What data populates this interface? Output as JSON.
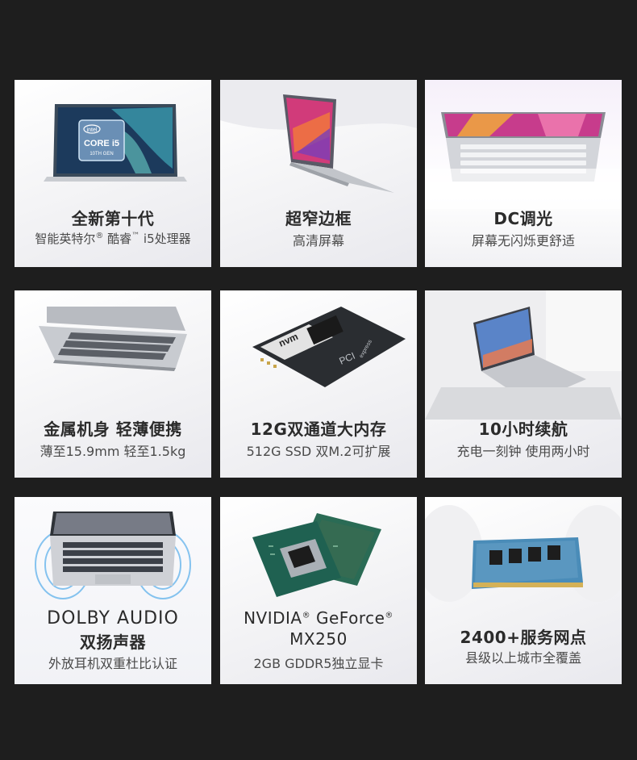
{
  "cards": [
    {
      "title": "全新第十代",
      "subtitle_main": "智能英特尔",
      "subtitle_reg": "®",
      "subtitle_mid": " 酷睿",
      "subtitle_tm": "™",
      "subtitle_end": " i5处理器",
      "chip_brand": "intel",
      "chip_line1": "CORE i5",
      "chip_line2": "10TH GEN"
    },
    {
      "title": "超窄边框",
      "subtitle": "高清屏幕"
    },
    {
      "title": "DC调光",
      "subtitle": "屏幕无闪烁更舒适"
    },
    {
      "title": "金属机身 轻薄便携",
      "subtitle": "薄至15.9mm 轻至1.5kg"
    },
    {
      "title": "12G双通道大内存",
      "subtitle": "512G SSD 双M.2可扩展",
      "ssd_label_a": "nvm",
      "ssd_label_b": "express",
      "ssd_label_c": "PCI"
    },
    {
      "title": "10小时续航",
      "subtitle": "充电一刻钟 使用两小时"
    },
    {
      "title_line1": "DOLBY AUDIO",
      "title_line2": "双扬声器",
      "subtitle": "外放耳机双重杜比认证"
    },
    {
      "title_line1_a": "NVIDIA",
      "title_line1_reg1": "®",
      "title_line1_b": " GeForce",
      "title_line1_reg2": "®",
      "title_line2": "MX250",
      "subtitle": "2GB GDDR5独立显卡"
    },
    {
      "title": "2400+服务网点",
      "subtitle": "县级以上城市全覆盖"
    }
  ],
  "colors": {
    "background": "#1e1e1e",
    "card": "#f4f4f6",
    "title": "#2b2b2b",
    "subtitle": "#4a4a4a"
  }
}
